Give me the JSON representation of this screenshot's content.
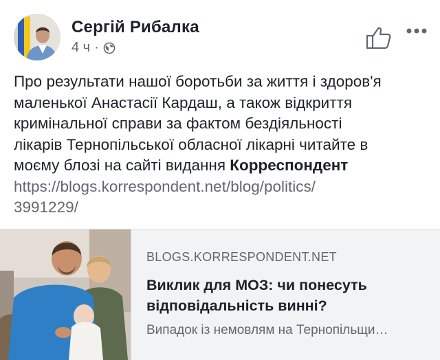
{
  "post": {
    "author": "Сергій Рибалка",
    "time": "4 ч",
    "separator": "·",
    "icons": {
      "privacy": "globe-icon",
      "like": "thumbs-up-icon",
      "more": "more-horizontal-icon"
    },
    "text_lines": [
      "Про результати нашої боротьби за життя і здоров'я",
      "маленької Анастасії Кардаш, а також відкриття",
      "кримінальної справи за фактом бездіяльності",
      "лікарів Тернопільської обласної лікарні читайте в",
      "моєму блозі на сайті видання "
    ],
    "bold_word": "Корреспондент",
    "link_lines": [
      "https://blogs.korrespondent.net/blog/politics/",
      "3991229/"
    ]
  },
  "card": {
    "domain": "BLOGS.KORRESPONDENT.NET",
    "title_lines": [
      "Виклик для МОЗ: чи понесуть",
      "відповідальність винні?"
    ],
    "description": "Випадок із немовлям на Тернопільщи…"
  },
  "colors": {
    "text": "#1d2129",
    "secondary": "#606770",
    "card_background": "#f2f3f5",
    "border": "#dadde1"
  }
}
